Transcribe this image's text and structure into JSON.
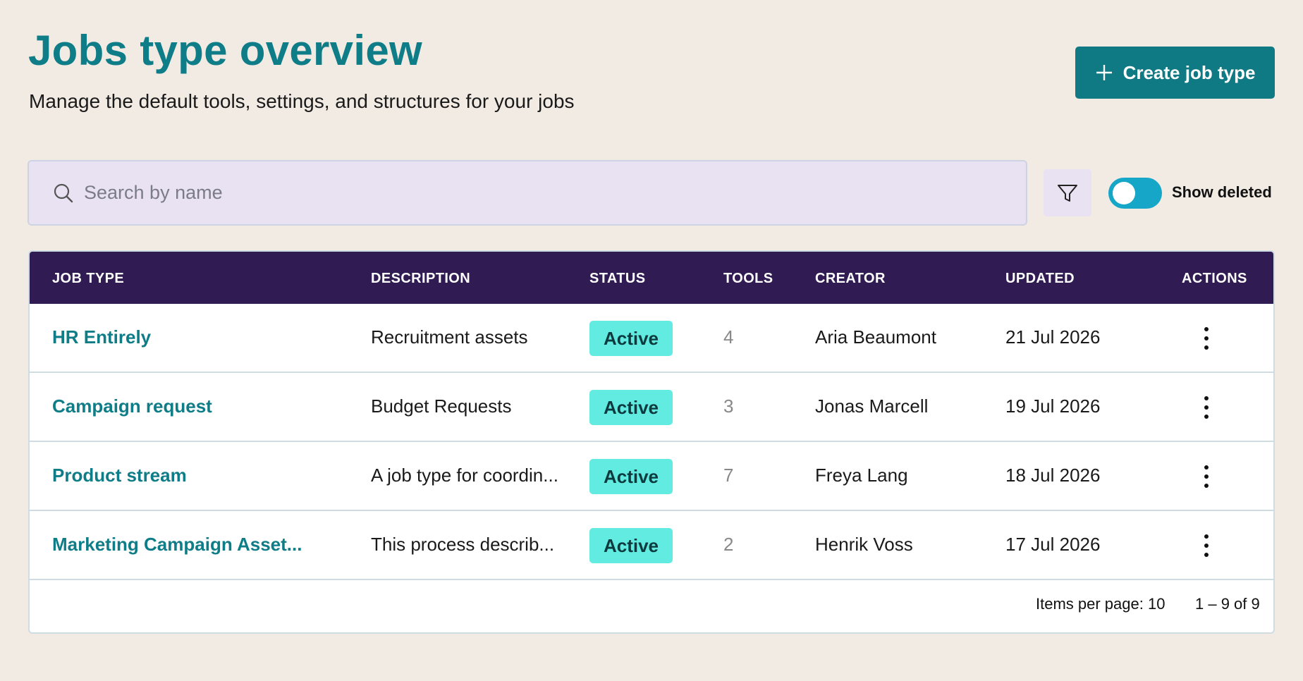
{
  "header": {
    "title": "Jobs type overview",
    "subtitle": "Manage the default tools, settings, and structures for your jobs",
    "create_button_label": "Create job type"
  },
  "search": {
    "placeholder": "Search by name",
    "value": ""
  },
  "filters": {
    "show_deleted_label": "Show deleted",
    "show_deleted_on": false
  },
  "table": {
    "columns": [
      "JOB TYPE",
      "DESCRIPTION",
      "STATUS",
      "TOOLS",
      "CREATOR",
      "UPDATED",
      "ACTIONS"
    ],
    "rows": [
      {
        "name": "HR Entirely",
        "description": "Recruitment assets",
        "status": "Active",
        "tools": "4",
        "creator": "Aria Beaumont",
        "updated": "21 Jul 2026"
      },
      {
        "name": "Campaign request",
        "description": "Budget Requests",
        "status": "Active",
        "tools": "3",
        "creator": "Jonas Marcell",
        "updated": "19 Jul 2026"
      },
      {
        "name": "Product stream",
        "description": "A job type for coordin...",
        "status": "Active",
        "tools": "7",
        "creator": "Freya Lang",
        "updated": "18 Jul 2026"
      },
      {
        "name": "Marketing Campaign Asset...",
        "description": "This process describ...",
        "status": "Active",
        "tools": "2",
        "creator": "Henrik Voss",
        "updated": "17 Jul 2026"
      }
    ]
  },
  "pagination": {
    "items_per_page": "Items per page: 10",
    "range": "1 – 9 of 9"
  },
  "colors": {
    "accent": "#0f7d87",
    "table_header": "#311b53",
    "status_active": "#62ece1",
    "toggle": "#16a6c8",
    "background": "#f2ebe4"
  }
}
